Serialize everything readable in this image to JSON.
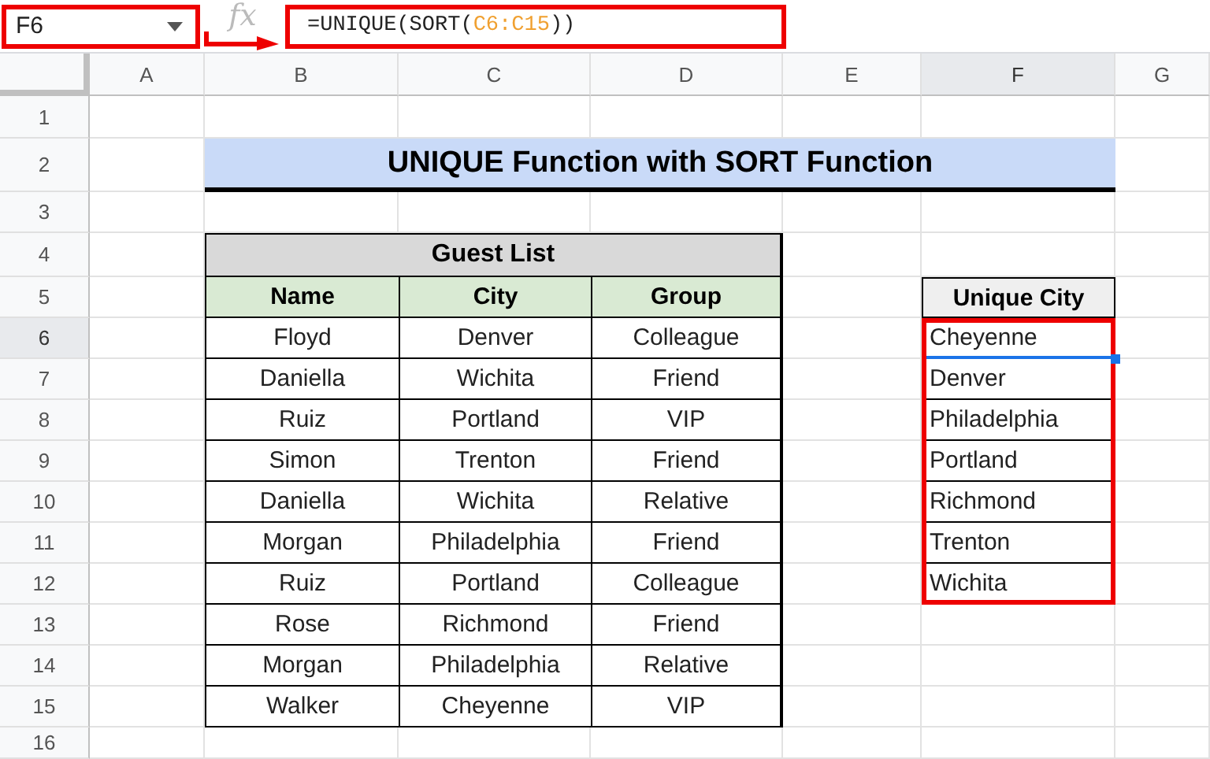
{
  "name_box": {
    "value": "F6"
  },
  "formula_bar": {
    "icon_text": "fx",
    "formula_start": "=UNIQUE(SORT(",
    "formula_range": "C6:C15",
    "formula_end": "))"
  },
  "columns": [
    {
      "label": "A",
      "selected": false
    },
    {
      "label": "B",
      "selected": false
    },
    {
      "label": "C",
      "selected": false
    },
    {
      "label": "D",
      "selected": false
    },
    {
      "label": "E",
      "selected": false
    },
    {
      "label": "F",
      "selected": true
    },
    {
      "label": "G",
      "selected": false
    }
  ],
  "rows": [
    {
      "label": "1",
      "selected": false
    },
    {
      "label": "2",
      "selected": false
    },
    {
      "label": "3",
      "selected": false
    },
    {
      "label": "4",
      "selected": false
    },
    {
      "label": "5",
      "selected": false
    },
    {
      "label": "6",
      "selected": true
    },
    {
      "label": "7",
      "selected": false
    },
    {
      "label": "8",
      "selected": false
    },
    {
      "label": "9",
      "selected": false
    },
    {
      "label": "10",
      "selected": false
    },
    {
      "label": "11",
      "selected": false
    },
    {
      "label": "12",
      "selected": false
    },
    {
      "label": "13",
      "selected": false
    },
    {
      "label": "14",
      "selected": false
    },
    {
      "label": "15",
      "selected": false
    },
    {
      "label": "16",
      "selected": false
    }
  ],
  "title": "UNIQUE Function with SORT Function",
  "guest_table": {
    "title": "Guest List",
    "columns": [
      "Name",
      "City",
      "Group"
    ],
    "rows": [
      [
        "Floyd",
        "Denver",
        "Colleague"
      ],
      [
        "Daniella",
        "Wichita",
        "Friend"
      ],
      [
        "Ruiz",
        "Portland",
        "VIP"
      ],
      [
        "Simon",
        "Trenton",
        "Friend"
      ],
      [
        "Daniella",
        "Wichita",
        "Relative"
      ],
      [
        "Morgan",
        "Philadelphia",
        "Friend"
      ],
      [
        "Ruiz",
        "Portland",
        "Colleague"
      ],
      [
        "Rose",
        "Richmond",
        "Friend"
      ],
      [
        "Morgan",
        "Philadelphia",
        "Relative"
      ],
      [
        "Walker",
        "Cheyenne",
        "VIP"
      ]
    ]
  },
  "unique_table": {
    "header": "Unique City",
    "values": [
      "Cheyenne",
      "Denver",
      "Philadelphia",
      "Portland",
      "Richmond",
      "Trenton",
      "Wichita"
    ]
  }
}
